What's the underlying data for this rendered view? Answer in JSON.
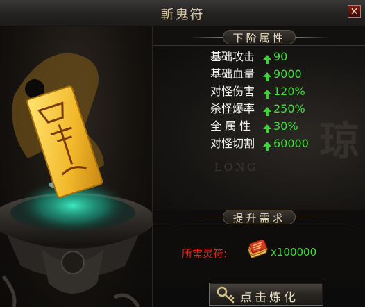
{
  "window": {
    "title": "斬鬼符",
    "close_label": "✕"
  },
  "attributes": {
    "header": "下阶属性",
    "items": [
      {
        "name": "基础攻击",
        "value": "90"
      },
      {
        "name": "基础血量",
        "value": "9000"
      },
      {
        "name": "对怪伤害",
        "value": "120%"
      },
      {
        "name": "杀怪爆率",
        "value": "250%"
      },
      {
        "name": "全 属 性",
        "value": "30%"
      },
      {
        "name": "对怪切割",
        "value": "60000"
      }
    ],
    "watermark": "琼",
    "watermark_en": "LONG"
  },
  "requirement": {
    "header": "提升需求",
    "label": "所需灵符:",
    "item_icon": "talisman-bundle-icon",
    "value": "x100000"
  },
  "action": {
    "label": "点击炼化",
    "icon": "key-icon"
  },
  "colors": {
    "green": "#3fe03a",
    "red": "#e0271f",
    "gold": "#d8c9a6"
  }
}
